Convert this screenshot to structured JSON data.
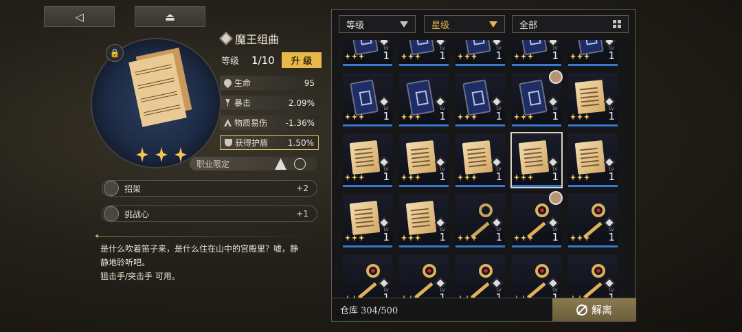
{
  "toolbar": {
    "back_icon": "◁",
    "eject_icon": "⏏"
  },
  "item": {
    "name": "魔王组曲",
    "level_label": "等级",
    "level_value": "1/10",
    "upgrade_label": "升 级",
    "stars": 3,
    "stats": [
      {
        "label": "生命",
        "value": "95",
        "icon": "heart-icon"
      },
      {
        "label": "暴击",
        "value": "2.09%",
        "icon": "crit-icon"
      },
      {
        "label": "物质易伤",
        "value": "-1.36%",
        "icon": "vulnerability-icon"
      },
      {
        "label": "获得护盾",
        "value": "1.50%",
        "icon": "shield-icon"
      }
    ],
    "class_limit_label": "职业限定",
    "skills": [
      {
        "name": "招架",
        "value": "+2"
      },
      {
        "name": "挑战心",
        "value": "+1"
      }
    ],
    "description": [
      "是什么吹着笛子来，是什么住在山中的宫殿里？嘘，静",
      "静地聆听吧。",
      "狙击手/突击手 可用。"
    ]
  },
  "filters": {
    "level": "等级",
    "star": "星级",
    "all": "全部"
  },
  "inventory": {
    "rows": [
      [
        "card",
        "card",
        "card",
        "card",
        "card"
      ],
      [
        "card",
        "card",
        "card",
        "card-avatar",
        "score"
      ],
      [
        "score",
        "score",
        "score",
        "score-selected",
        "score"
      ],
      [
        "score",
        "score",
        "key-grey",
        "key-avatar",
        "key"
      ],
      [
        "key",
        "key",
        "key",
        "key",
        "key"
      ]
    ],
    "level_small": "LV",
    "level_value": "1"
  },
  "footer": {
    "storage": "仓库 304/500",
    "dismantle_label": "解离"
  },
  "colors": {
    "accent": "#e8b84a",
    "rarity_bar": "#3a78d0",
    "panel_bg": "#161618"
  }
}
